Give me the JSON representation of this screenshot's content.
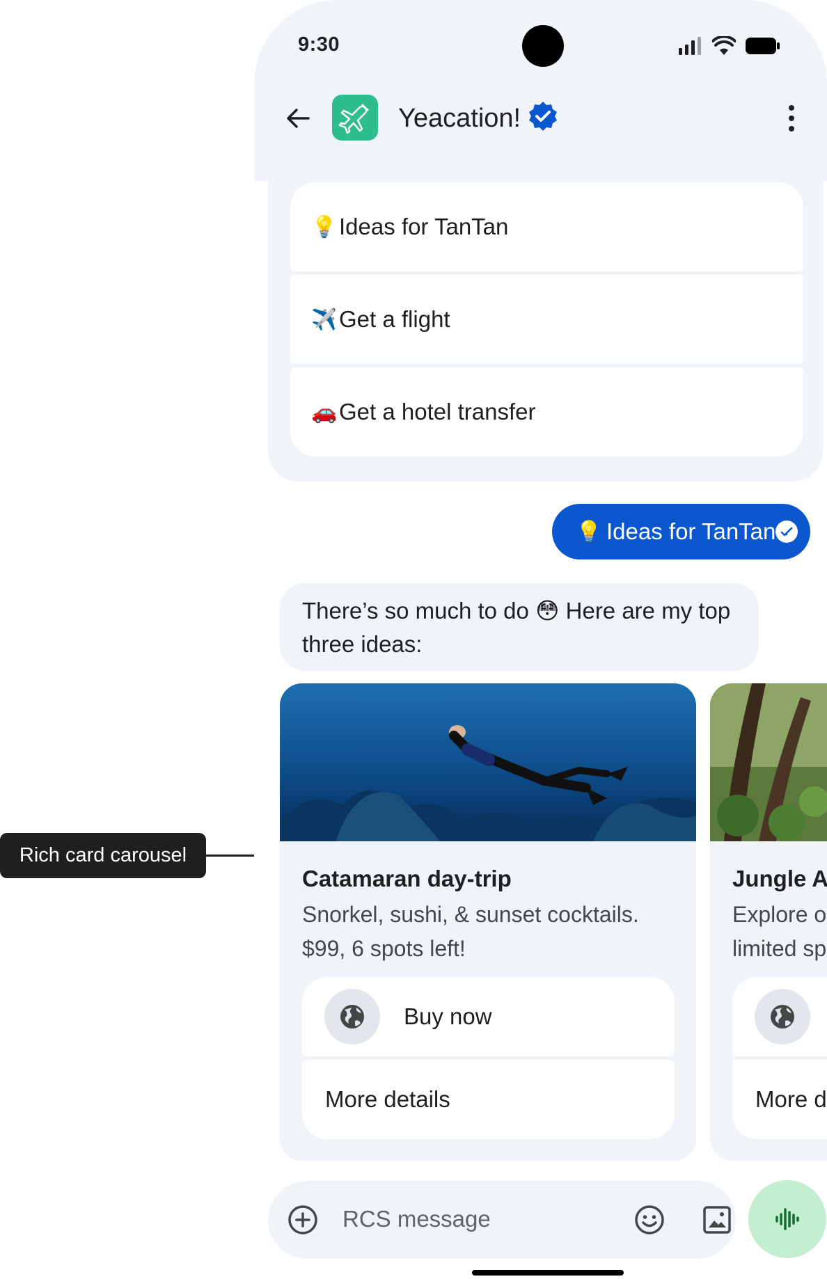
{
  "status_bar": {
    "time": "9:30"
  },
  "header": {
    "title": "Yeacation!"
  },
  "suggestions": [
    {
      "emoji": "💡",
      "label": "Ideas for TanTan"
    },
    {
      "emoji": "✈️",
      "label": "Get a flight"
    },
    {
      "emoji": "🚗",
      "label": "Get a hotel transfer"
    }
  ],
  "outgoing_message": {
    "emoji": "💡",
    "text": "Ideas for TanTan"
  },
  "incoming_message": {
    "line1_a": "There’s so much to do ",
    "emoji": "😳",
    "line1_b": " Here are my top",
    "line2": "three ideas:"
  },
  "cards": [
    {
      "title": "Catamaran day-trip",
      "desc_line1": "Snorkel, sushi, & sunset cocktails.",
      "desc_line2": "$99, 6 spots left!",
      "action_primary": "Buy now",
      "action_secondary": "More details"
    },
    {
      "title": "Jungle AT",
      "desc_line1": "Explore o",
      "desc_line2": "limited sp",
      "action_primary": "",
      "action_secondary": "More d"
    }
  ],
  "composer": {
    "placeholder": "RCS message"
  },
  "annotation": {
    "label": "Rich card carousel"
  },
  "colors": {
    "accent": "#0b57d0",
    "surface": "#f0f4f9",
    "mic_bg": "#c4eed0",
    "logo": "#2dbd8f"
  }
}
